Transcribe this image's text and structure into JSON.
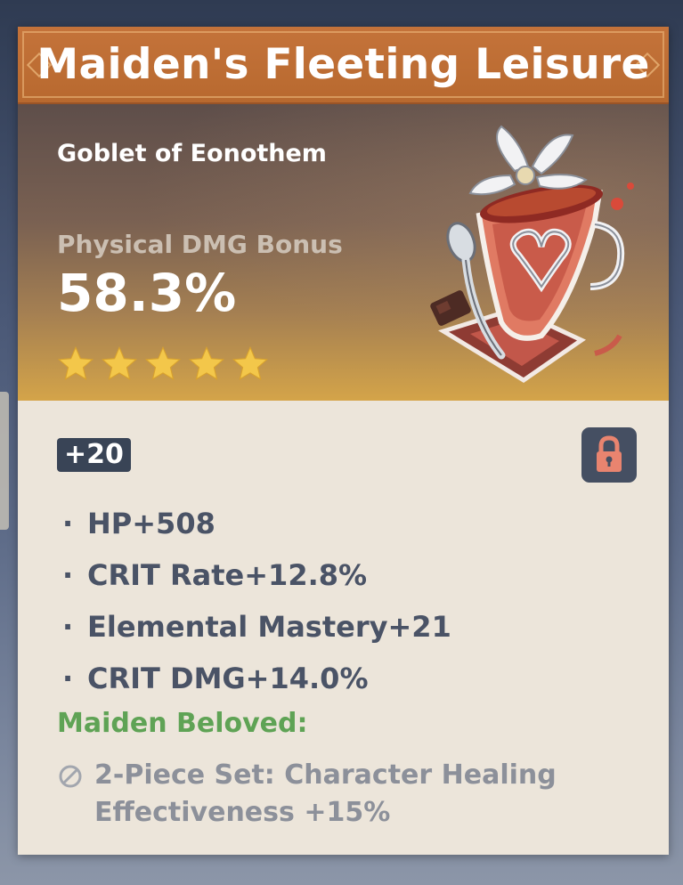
{
  "artifact": {
    "name": "Maiden's Fleeting Leisure",
    "slot": "Goblet of Eonothem",
    "main_stat": {
      "label": "Physical DMG Bonus",
      "value": "58.3%"
    },
    "rarity_stars": 5,
    "level": "+20",
    "locked": true,
    "substats": [
      {
        "text": "HP+508"
      },
      {
        "text": "CRIT Rate+12.8%"
      },
      {
        "text": "Elemental Mastery+21"
      },
      {
        "text": "CRIT DMG+14.0%"
      }
    ],
    "set": {
      "name": "Maiden Beloved:",
      "bonus_2pc": "2-Piece Set: Character Healing Effectiveness +15%"
    }
  },
  "colors": {
    "title_bar": "#c4733a",
    "star": "#f3c74a",
    "set_name": "#5fa355",
    "inactive_text": "#8c909a",
    "substat_text": "#4a5366",
    "lock_button": "#454f62",
    "lock_icon": "#e9846f"
  },
  "icons": {
    "star": "star-icon",
    "lock": "lock-icon",
    "inactive": "inactive-circle-slash-icon",
    "artifact": "goblet-artifact-icon"
  },
  "bullet": "·"
}
